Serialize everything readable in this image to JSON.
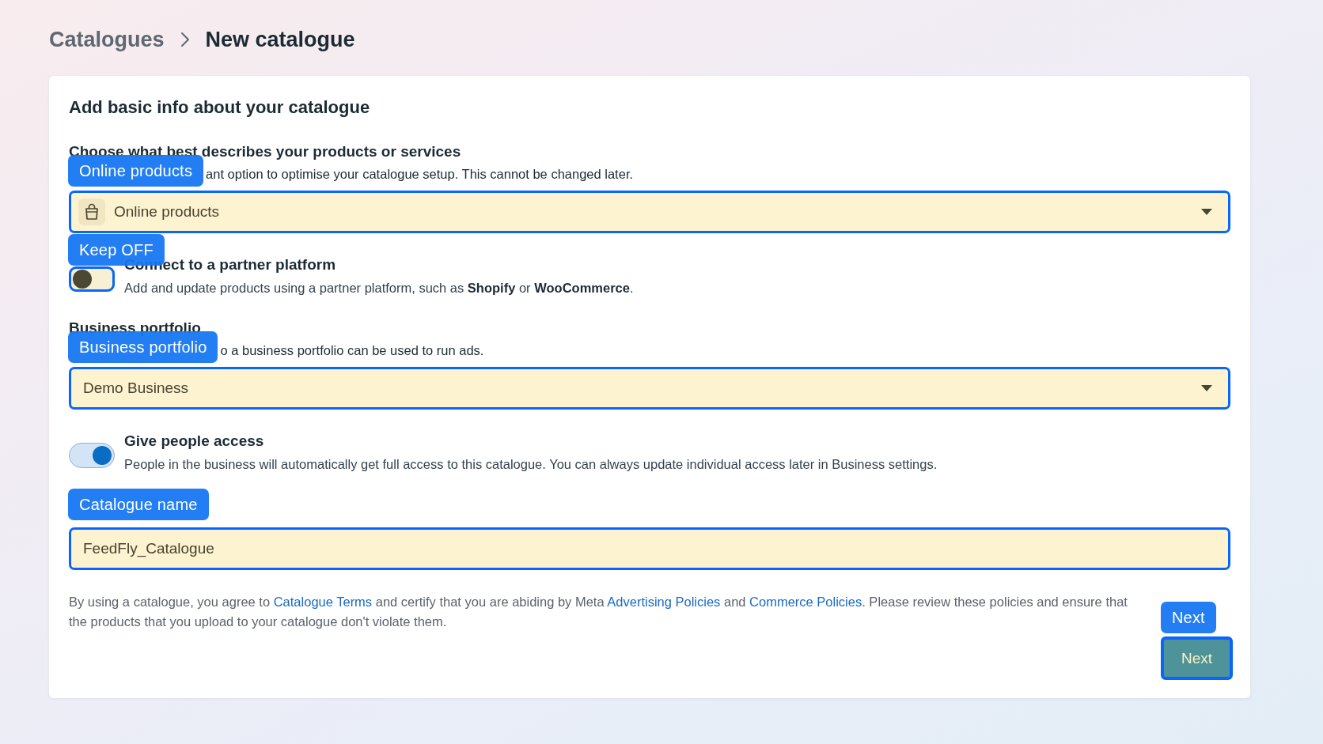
{
  "breadcrumb": [
    {
      "label": "Catalogues",
      "current": false
    },
    {
      "label": "New catalogue",
      "current": true
    }
  ],
  "card": {
    "title": "Add basic info about your catalogue",
    "sections": [
      {
        "kind": "icon-select",
        "heading": "Choose what best describes your products or services",
        "hint": "ant option to optimise your catalogue setup. This cannot be changed later.",
        "value": "Online products",
        "annotation": "Online products"
      },
      {
        "kind": "toggle",
        "heading": "Connect to a partner platform",
        "description": "Add and update products using a partner platform, such as **Shopify** or **WooCommerce**.",
        "on": false,
        "annotation": "Keep OFF"
      },
      {
        "kind": "select",
        "heading": "Business portfolio",
        "hint": "o a business portfolio can be used to run ads.",
        "value": "Demo Business",
        "annotation": "Business portfolio"
      },
      {
        "kind": "toggle",
        "heading": "Give people access",
        "description": "People in the business will automatically get full access to this catalogue. You can always update individual access later in Business settings.",
        "on": true
      },
      {
        "kind": "text-input",
        "value": "FeedFly_Catalogue",
        "annotation": "Catalogue name"
      }
    ],
    "legal_text": [
      {
        "kind": "text",
        "text": "By using a catalogue, you agree to "
      },
      {
        "kind": "link",
        "text": "Catalogue Terms"
      },
      {
        "kind": "text",
        "text": " and certify that you are abiding by Meta "
      },
      {
        "kind": "link",
        "text": "Advertising Policies"
      },
      {
        "kind": "text",
        "text": " and "
      },
      {
        "kind": "link",
        "text": "Commerce Policies"
      },
      {
        "kind": "text",
        "text": ". Please review these policies and ensure that the products that you upload to your catalogue don't violate them."
      }
    ],
    "next_button": {
      "label": "Next",
      "annotation": "Next"
    }
  }
}
